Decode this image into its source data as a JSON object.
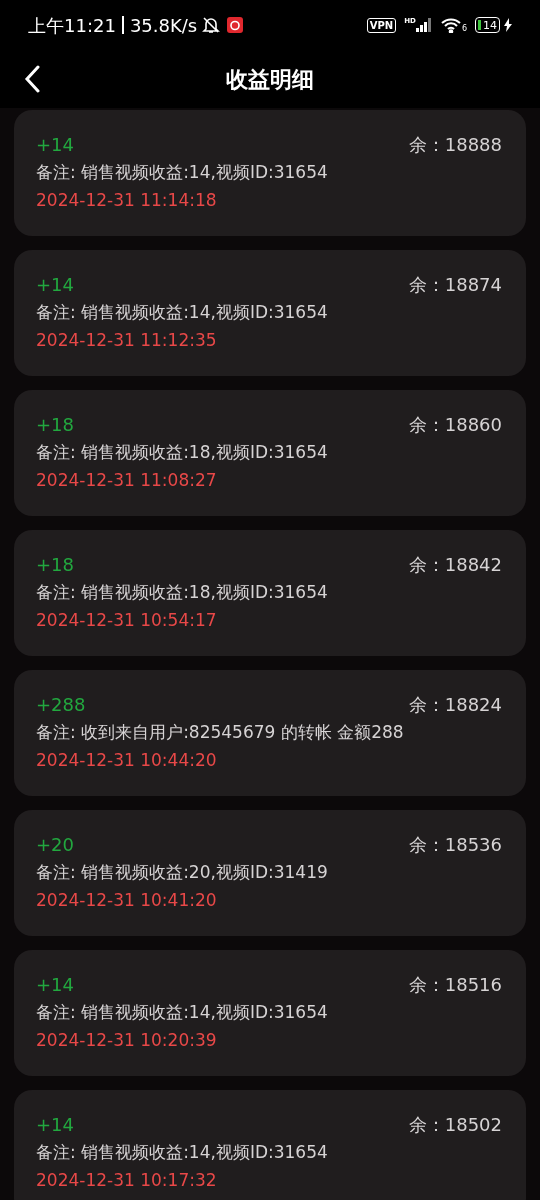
{
  "status_bar": {
    "time": "上午11:21",
    "speed": "35.8K/s",
    "vpn": "VPN",
    "network": "HD",
    "wifi": "6",
    "battery": "14"
  },
  "header": {
    "title": "收益明细"
  },
  "records": [
    {
      "amount": "+14",
      "balance": "余：18888",
      "note": "备注: 销售视频收益:14,视频ID:31654",
      "time": "2024-12-31 11:14:18"
    },
    {
      "amount": "+14",
      "balance": "余：18874",
      "note": "备注: 销售视频收益:14,视频ID:31654",
      "time": "2024-12-31 11:12:35"
    },
    {
      "amount": "+18",
      "balance": "余：18860",
      "note": "备注: 销售视频收益:18,视频ID:31654",
      "time": "2024-12-31 11:08:27"
    },
    {
      "amount": "+18",
      "balance": "余：18842",
      "note": "备注: 销售视频收益:18,视频ID:31654",
      "time": "2024-12-31 10:54:17"
    },
    {
      "amount": "+288",
      "balance": "余：18824",
      "note": "备注: 收到来自用户:82545679 的转帐 金额288",
      "time": "2024-12-31 10:44:20"
    },
    {
      "amount": "+20",
      "balance": "余：18536",
      "note": "备注: 销售视频收益:20,视频ID:31419",
      "time": "2024-12-31 10:41:20"
    },
    {
      "amount": "+14",
      "balance": "余：18516",
      "note": "备注: 销售视频收益:14,视频ID:31654",
      "time": "2024-12-31 10:20:39"
    },
    {
      "amount": "+14",
      "balance": "余：18502",
      "note": "备注: 销售视频收益:14,视频ID:31654",
      "time": "2024-12-31 10:17:32"
    }
  ]
}
